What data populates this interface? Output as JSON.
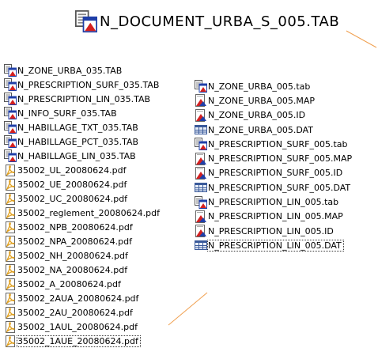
{
  "title": {
    "label": "N_DOCUMENT_URBA_S_005.TAB",
    "icon": "mapinfo-table-icon"
  },
  "left_list": [
    {
      "label": "N_ZONE_URBA_035.TAB",
      "icon": "mapinfo-table-icon"
    },
    {
      "label": "N_PRESCRIPTION_SURF_035.TAB",
      "icon": "mapinfo-table-icon"
    },
    {
      "label": "N_PRESCRIPTION_LIN_035.TAB",
      "icon": "mapinfo-table-icon"
    },
    {
      "label": "N_INFO_SURF_035.TAB",
      "icon": "mapinfo-table-icon"
    },
    {
      "label": "N_HABILLAGE_TXT_035.TAB",
      "icon": "mapinfo-table-icon"
    },
    {
      "label": "N_HABILLAGE_PCT_035.TAB",
      "icon": "mapinfo-table-icon"
    },
    {
      "label": "N_HABILLAGE_LIN_035.TAB",
      "icon": "mapinfo-table-icon"
    },
    {
      "label": "35002_UL_20080624.pdf",
      "icon": "pdf-file-icon"
    },
    {
      "label": "35002_UE_20080624.pdf",
      "icon": "pdf-file-icon"
    },
    {
      "label": "35002_UC_20080624.pdf",
      "icon": "pdf-file-icon"
    },
    {
      "label": "35002_reglement_20080624.pdf",
      "icon": "pdf-file-icon"
    },
    {
      "label": "35002_NPB_20080624.pdf",
      "icon": "pdf-file-icon"
    },
    {
      "label": "35002_NPA_20080624.pdf",
      "icon": "pdf-file-icon"
    },
    {
      "label": "35002_NH_20080624.pdf",
      "icon": "pdf-file-icon"
    },
    {
      "label": "35002_NA_20080624.pdf",
      "icon": "pdf-file-icon"
    },
    {
      "label": "35002_A_20080624.pdf",
      "icon": "pdf-file-icon"
    },
    {
      "label": "35002_2AUA_20080624.pdf",
      "icon": "pdf-file-icon"
    },
    {
      "label": "35002_2AU_20080624.pdf",
      "icon": "pdf-file-icon"
    },
    {
      "label": "35002_1AUL_20080624.pdf",
      "icon": "pdf-file-icon"
    },
    {
      "label": "35002_1AUE_20080624.pdf",
      "icon": "pdf-file-icon",
      "selected": true
    }
  ],
  "right_list": [
    {
      "label": "N_ZONE_URBA_005.tab",
      "icon": "mapinfo-table-icon"
    },
    {
      "label": "N_ZONE_URBA_005.MAP",
      "icon": "map-file-icon"
    },
    {
      "label": "N_ZONE_URBA_005.ID",
      "icon": "map-file-icon"
    },
    {
      "label": "N_ZONE_URBA_005.DAT",
      "icon": "dat-file-icon"
    },
    {
      "label": "N_PRESCRIPTION_SURF_005.tab",
      "icon": "mapinfo-table-icon"
    },
    {
      "label": "N_PRESCRIPTION_SURF_005.MAP",
      "icon": "map-file-icon"
    },
    {
      "label": "N_PRESCRIPTION_SURF_005.ID",
      "icon": "map-file-icon"
    },
    {
      "label": "N_PRESCRIPTION_SURF_005.DAT",
      "icon": "dat-file-icon"
    },
    {
      "label": "N_PRESCRIPTION_LIN_005.tab",
      "icon": "mapinfo-table-icon"
    },
    {
      "label": "N_PRESCRIPTION_LIN_005.MAP",
      "icon": "map-file-icon"
    },
    {
      "label": "N_PRESCRIPTION_LIN_005.ID",
      "icon": "map-file-icon"
    },
    {
      "label": "N_PRESCRIPTION_LIN_005.DAT",
      "icon": "dat-file-icon",
      "selected": true
    }
  ],
  "colors": {
    "connector": "#f0a050",
    "mapinfo_red": "#d42020",
    "mapinfo_blue": "#1f3fa8"
  }
}
